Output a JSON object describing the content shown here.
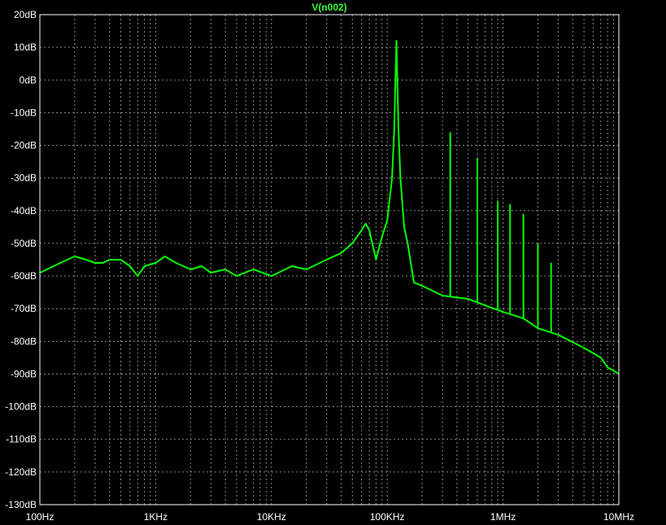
{
  "chart_data": {
    "type": "line",
    "title": "V(n002)",
    "xlabel": "",
    "ylabel": "",
    "x_scale": "log",
    "xlim": [
      100,
      10000000
    ],
    "ylim": [
      -130,
      20
    ],
    "grid": true,
    "x_tick_labels": [
      "100Hz",
      "1KHz",
      "10KHz",
      "100KHz",
      "1MHz",
      "10MHz"
    ],
    "y_tick_labels": [
      "20dB",
      "10dB",
      "0dB",
      "-10dB",
      "-20dB",
      "-30dB",
      "-40dB",
      "-50dB",
      "-60dB",
      "-70dB",
      "-80dB",
      "-90dB",
      "-100dB",
      "-110dB",
      "-120dB",
      "-130dB"
    ],
    "series": [
      {
        "name": "V(n002)",
        "color": "#00ff00",
        "x": [
          100,
          150,
          200,
          250,
          300,
          350,
          400,
          450,
          500,
          600,
          700,
          800,
          1000,
          1200,
          1500,
          2000,
          2500,
          3000,
          4000,
          5000,
          7000,
          10000,
          15000,
          20000,
          30000,
          40000,
          50000,
          60000,
          65000,
          70000,
          80000,
          90000,
          100000,
          110000,
          115000,
          120000,
          125000,
          130000,
          140000,
          150000,
          170000,
          200000,
          300000,
          500000,
          700000,
          1000000,
          1500000,
          2000000,
          3000000,
          5000000,
          7000000,
          8000000,
          9000000,
          10000000,
          12000000
        ],
        "values": [
          -59,
          -56,
          -54,
          -55,
          -56,
          -56,
          -55,
          -55,
          -55,
          -57,
          -60,
          -57,
          -56,
          -54,
          -56,
          -58,
          -57,
          -59,
          -58,
          -60,
          -58,
          -60,
          -57,
          -58,
          -55,
          -53,
          -50,
          -46,
          -44,
          -46,
          -55,
          -48,
          -43,
          -30,
          -15,
          12,
          -15,
          -30,
          -45,
          -50,
          -62,
          -63,
          -66,
          -67,
          -69,
          -71,
          -73,
          -76,
          -78,
          -82,
          -85,
          -88,
          -89,
          -90,
          -91
        ]
      }
    ],
    "spikes": [
      {
        "x": 350000,
        "y": -16
      },
      {
        "x": 600000,
        "y": -24
      },
      {
        "x": 900000,
        "y": -37
      },
      {
        "x": 1150000,
        "y": -38
      },
      {
        "x": 1500000,
        "y": -41
      },
      {
        "x": 2000000,
        "y": -50
      },
      {
        "x": 2600000,
        "y": -56
      }
    ]
  }
}
